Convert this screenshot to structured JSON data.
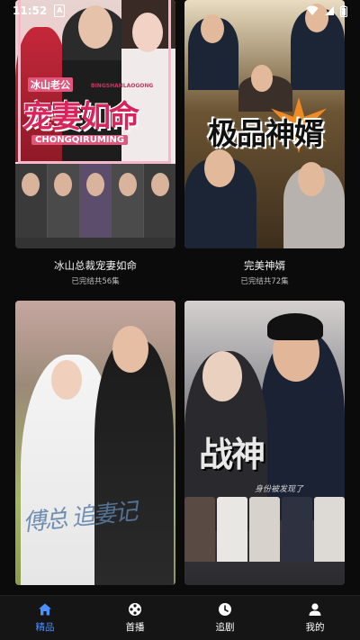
{
  "status_bar": {
    "time": "11:52",
    "notification_badge": "A"
  },
  "cards": [
    {
      "title": "冰山总裁宠妻如命",
      "episodes": "已完结共56集",
      "poster_text": {
        "tag": "冰山老公",
        "pinyin_top": "BINGSHANLAOGONG",
        "headline": "宠妻如命",
        "pinyin_bottom": "CHONGQIRUMING"
      }
    },
    {
      "title": "完美神婿",
      "episodes": "已完结共72集",
      "poster_text": {
        "headline": "极品神婿"
      }
    },
    {
      "title": "",
      "episodes": "",
      "poster_text": {
        "script": "傅总 追妻记"
      }
    },
    {
      "title": "",
      "episodes": "",
      "poster_text": {
        "headline": "战神",
        "sub": "身份被发现了"
      }
    }
  ],
  "bottom_nav": [
    {
      "label": "精品",
      "icon": "home-icon",
      "active": true
    },
    {
      "label": "首播",
      "icon": "film-reel-icon",
      "active": false
    },
    {
      "label": "追剧",
      "icon": "clock-icon",
      "active": false
    },
    {
      "label": "我的",
      "icon": "person-icon",
      "active": false
    }
  ],
  "colors": {
    "background": "#0b0b0b",
    "nav_background": "#151515",
    "accent": "#4a90ff",
    "text": "#ffffff",
    "subtext": "#bdbdbd"
  }
}
